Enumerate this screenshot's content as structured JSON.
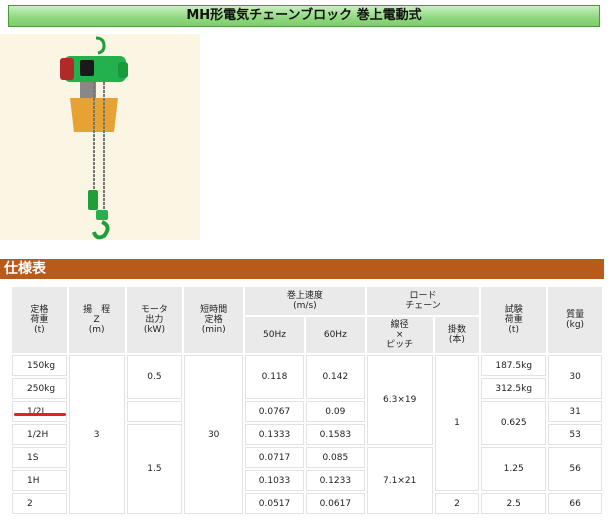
{
  "title": "MH形電気チェーンブロック 巻上電動式",
  "section": "仕様表",
  "table": {
    "headers": {
      "rated_load": [
        "定格",
        "荷重",
        "(t)"
      ],
      "lift": [
        "揚　程",
        "Z",
        "(m)"
      ],
      "motor": [
        "モータ",
        "出力",
        "(kW)"
      ],
      "short_time": [
        "短時間",
        "定格",
        "(min)"
      ],
      "speed": [
        "巻上速度",
        "(m/s)"
      ],
      "hz50": "50Hz",
      "hz60": "60Hz",
      "load_chain": [
        "ロード",
        "チェーン"
      ],
      "dia_pitch": [
        "線径",
        "×",
        "ピッチ"
      ],
      "falls": [
        "掛数",
        "(本)"
      ],
      "test_load": [
        "試験",
        "荷重",
        "(t)"
      ],
      "weight": [
        "質量",
        "(kg)"
      ]
    },
    "capacity": [
      "150kg",
      "250kg",
      "1/2L",
      "1/2H",
      "1S",
      "1H",
      "2"
    ],
    "lift": "3",
    "motor": [
      "0.5",
      "1.5"
    ],
    "short_time": "30",
    "speed50": [
      "0.118",
      "0.0767",
      "0.1333",
      "0.0717",
      "0.1033",
      "0.0517"
    ],
    "speed60": [
      "0.142",
      "0.09",
      "0.1583",
      "0.085",
      "0.1233",
      "0.0617"
    ],
    "chain": [
      "6.3×19",
      "7.1×21"
    ],
    "falls": [
      "1",
      "2"
    ],
    "test_load": [
      "187.5kg",
      "312.5kg",
      "0.625",
      "1.25",
      "2.5"
    ],
    "weight": [
      "30",
      "31",
      "53",
      "56",
      "66"
    ]
  }
}
